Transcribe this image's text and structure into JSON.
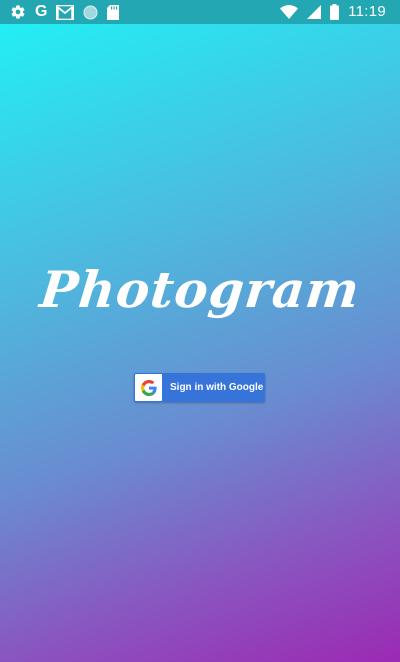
{
  "status_bar": {
    "time": "11:19",
    "g_label": "G",
    "left_icons": [
      "settings-icon",
      "google-icon",
      "gmail-icon",
      "circle-icon",
      "sd-card-icon"
    ],
    "right_icons": [
      "wifi-icon",
      "signal-icon",
      "battery-icon"
    ]
  },
  "app": {
    "title": "Photogram"
  },
  "signin": {
    "label": "Sign in with Google",
    "icon": "google-g-icon",
    "color": "#3674d9"
  },
  "colors": {
    "status_bar": "#22a7b3",
    "gradient_top": "#1ff3f5",
    "gradient_bottom": "#9b2ab3"
  }
}
